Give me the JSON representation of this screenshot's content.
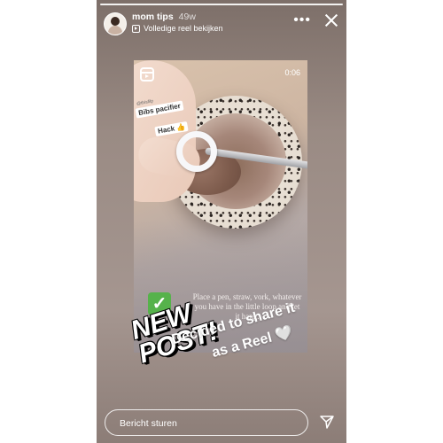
{
  "story": {
    "username": "mom tips",
    "age": "49w",
    "reel_link_label": "Volledige reel bekijken",
    "more_label": "•••"
  },
  "reel": {
    "timer": "0:06",
    "sticker_small": "@thisfilp",
    "sticker_line1": "Bibs pacifier",
    "sticker_line2": "Hack 👍",
    "check": "✓",
    "caption": "Place a pen, straw, vork, whatever you have in the little loop and let it hang."
  },
  "overlay": {
    "new_post_line1": "NEW",
    "new_post_line2": "POST!",
    "share_line1": "Decided to share it",
    "share_line2": "as a Reel 🤍"
  },
  "composer": {
    "placeholder": "Bericht sturen"
  },
  "icons": [
    "reel-icon",
    "more-icon",
    "close-icon",
    "send-icon"
  ]
}
